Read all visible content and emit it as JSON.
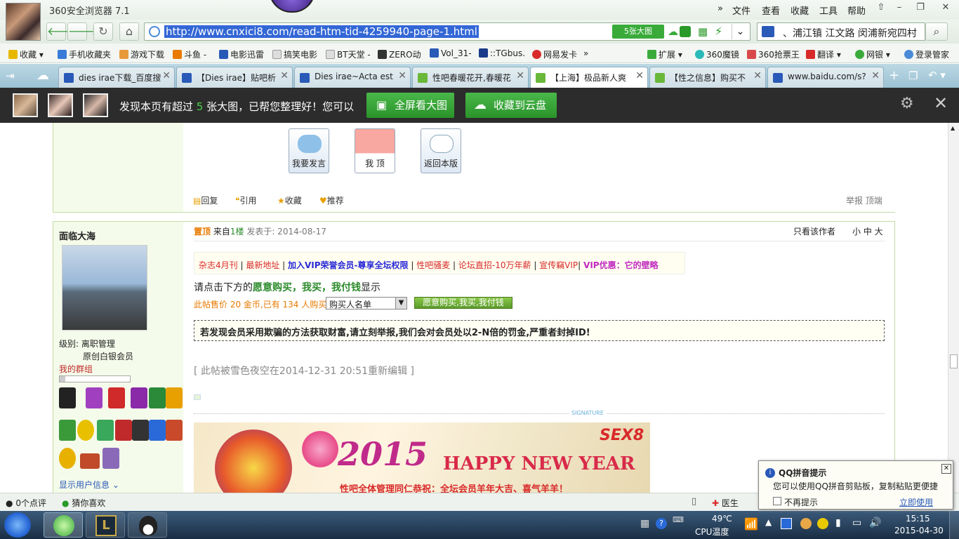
{
  "window": {
    "title": "360安全浏览器 7.1"
  },
  "menu": [
    "文件",
    "查看",
    "收藏",
    "工具",
    "帮助"
  ],
  "address": {
    "url": "http://www.cnxici8.com/read-htm-tid-4259940-page-1.html",
    "bigimg_label": "5张大图"
  },
  "search": {
    "value": "、浦江镇 江文路 闵浦新宛四村"
  },
  "bookmarks": [
    "收藏",
    "手机收藏夹",
    "游戏下载",
    "斗鱼 -",
    "电影迅雷",
    "搞笑电影",
    "BT天堂 -",
    "ZERO动",
    "Vol_31-",
    "::TGbus.",
    "网易发卡",
    "扩展",
    "360魔镜",
    "360抢票王",
    "翻译",
    "网银",
    "登录管家"
  ],
  "tabs": [
    {
      "label": "dies irae下载_百度搜"
    },
    {
      "label": "【Dies irae】贴吧析"
    },
    {
      "label": "Dies irae~Acta est"
    },
    {
      "label": "性吧春暖花开,春暖花"
    },
    {
      "label": "【上海】极品新人爽"
    },
    {
      "label": "【性之信息】购买不"
    },
    {
      "label": "www.baidu.com/s?"
    }
  ],
  "imgbar": {
    "msg_prefix": "发现本页有超过",
    "count": "5",
    "msg_suffix": "张大图，已帮您整理好！您可以",
    "fullscreen_label": "全屏看大图",
    "cloud_label": "收藏到云盘"
  },
  "post1": {
    "buttons": [
      "我要发言",
      "我 顶",
      "返回本版"
    ],
    "links": [
      "回复",
      "引用",
      "收藏",
      "推荐"
    ],
    "right_links": "举报 顶端"
  },
  "post2": {
    "username": "面临大海",
    "level_label": "级别: 离职管理",
    "level_sub": "原创白银会员",
    "group_label": "我的群组",
    "show_info": "显示用户信息",
    "top_label": "置顶",
    "from_prefix": "来自",
    "floor": "1楼",
    "posted": "发表于: 2014-08-17",
    "only_author": "只看该作者",
    "font_sizes": "小 中 大",
    "vip_links": [
      "杂志4月刊",
      "最新地址",
      "加入VIP荣誉会员-尊享全坛权限",
      "性吧骚麦",
      "论坛直招-10万年薪",
      "宣传竊VIP",
      "VIP优惠：它的壁略"
    ],
    "click_prefix": "请点击下方的",
    "click_bold": "愿意购买，我买，我付钱",
    "click_suffix": "显示",
    "price_text": "此帖售价 20 金币,已有 134 人购买",
    "buyer_select": "购买人名单",
    "buy_button": "愿意购买,我买,我付钱",
    "warning": "若发现会员采用欺骗的方法获取财富,请立刻举报,我们会对会员处以2-N倍的罚金,严重者封掉ID!",
    "edit_note": "[ 此帖被雪色夜空在2014-12-31 20:51重新编辑 ]",
    "signature_label": "SIGNATURE",
    "banner_year": "2015",
    "banner_title": "HAPPY NEW YEAR",
    "banner_logo": "SEX8",
    "banner_text": "性吧全体管理同仁恭祝：全坛会员羊年大吉、喜气羊羊！"
  },
  "statusbar": {
    "comments": "0个点评",
    "like": "猜你喜欢",
    "doctor": "医生"
  },
  "qq": {
    "title": "QQ拼音提示",
    "message": "您可以使用QQ拼音剪贴板，复制粘贴更便捷",
    "checkbox": "不再提示",
    "link": "立即使用"
  },
  "tray": {
    "temp": "49℃",
    "temp_label": "CPU温度",
    "time": "15:15",
    "date": "2015-04-30"
  }
}
